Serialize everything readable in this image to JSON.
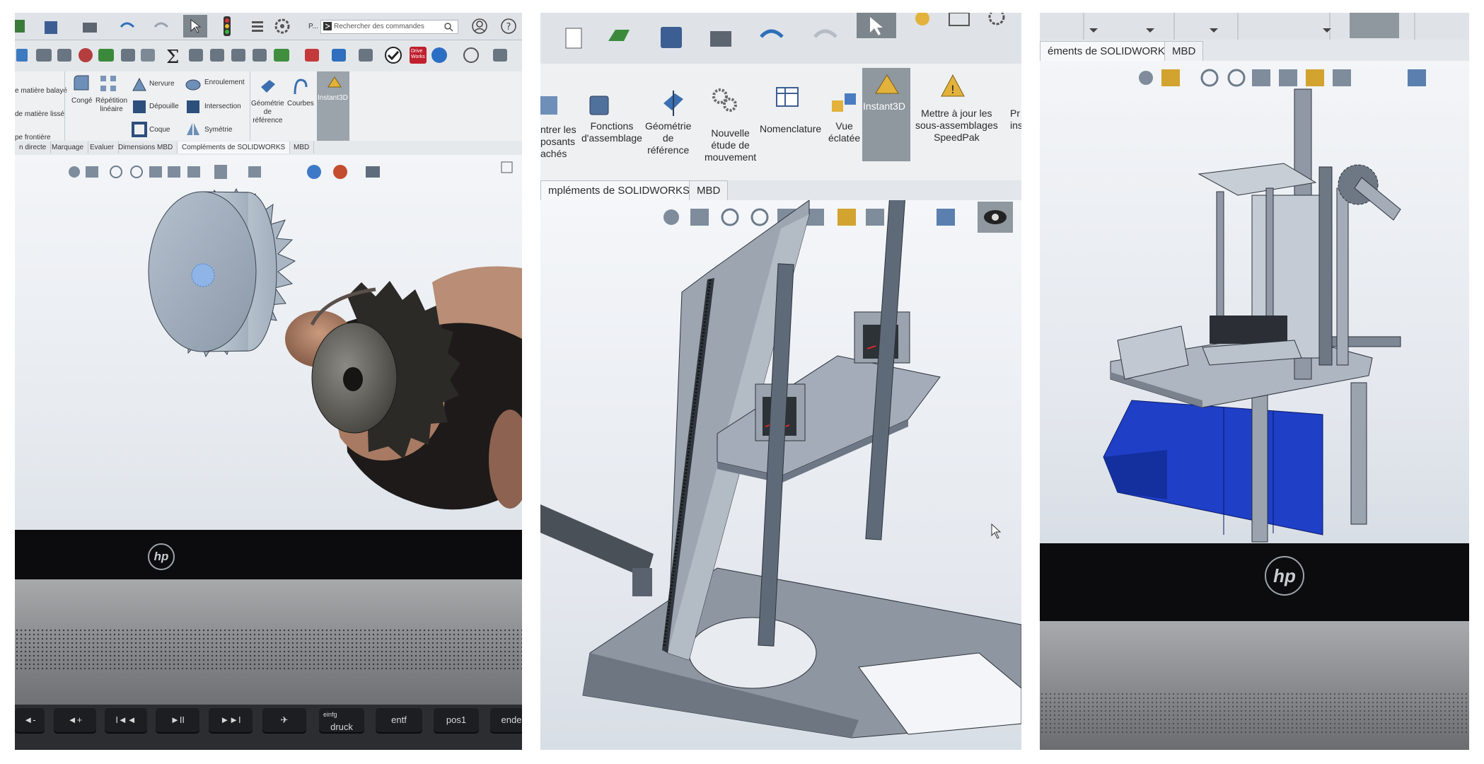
{
  "photo1": {
    "search": {
      "icon": "search-icon",
      "placeholder": "Rechercher des commandes"
    },
    "toolbar_abbrev": "P...",
    "ribbon": {
      "items": [
        "e matière balayé",
        "de matière lissé",
        "pe frontière",
        "Congé",
        "Répétition\nlinéaire",
        "Nervure",
        "Dépouille",
        "Coque",
        "Enroulement",
        "Intersection",
        "Symétrie",
        "Géométrie\nde\nréférence",
        "Courbes",
        "Instant3D"
      ]
    },
    "tabs": [
      "n directe",
      "Marquage",
      "Evaluer",
      "Dimensions MBD",
      "Compléments de SOLIDWORKS",
      "MBD"
    ],
    "ribbon_icon_text": "Drive\nWorks",
    "laptop_logo": "hp",
    "keys": [
      {
        "top": "fn",
        "label": "◄-"
      },
      {
        "top": "fn",
        "label": "◄+"
      },
      {
        "top": "fn",
        "label": "I◄◄"
      },
      {
        "top": "fn",
        "label": "►II"
      },
      {
        "top": "fn",
        "label": "►►I"
      },
      {
        "top": "fn",
        "label": "✈"
      },
      {
        "top": "einfg",
        "label": "druck"
      },
      {
        "top": "",
        "label": "entf"
      },
      {
        "top": "",
        "label": "pos1"
      },
      {
        "top": "",
        "label": "ende"
      }
    ]
  },
  "photo2": {
    "ribbon": {
      "items": [
        "ntrer les\nposants\nachés",
        "Fonctions\nd'assemblage",
        "Géométrie\nde\nréférence",
        "Nouvelle\nétude de\nmouvement",
        "Nomenclature",
        "Vue\néclatée",
        "Instant3D",
        "Mettre à jour les\nsous-assemblages\nSpeedPak",
        "Pr\nins"
      ]
    },
    "tabs": [
      "mpléments de SOLIDWORKS",
      "MBD"
    ]
  },
  "photo3": {
    "tabs": [
      "éments de SOLIDWORKS",
      "MBD"
    ],
    "laptop_logo": "hp"
  },
  "colors": {
    "cad_gray": "#aeb7c2",
    "cad_blue": "#1f3fc7",
    "gear_steel": "#4b4a47",
    "selection_blue": "#8fb4e6"
  }
}
